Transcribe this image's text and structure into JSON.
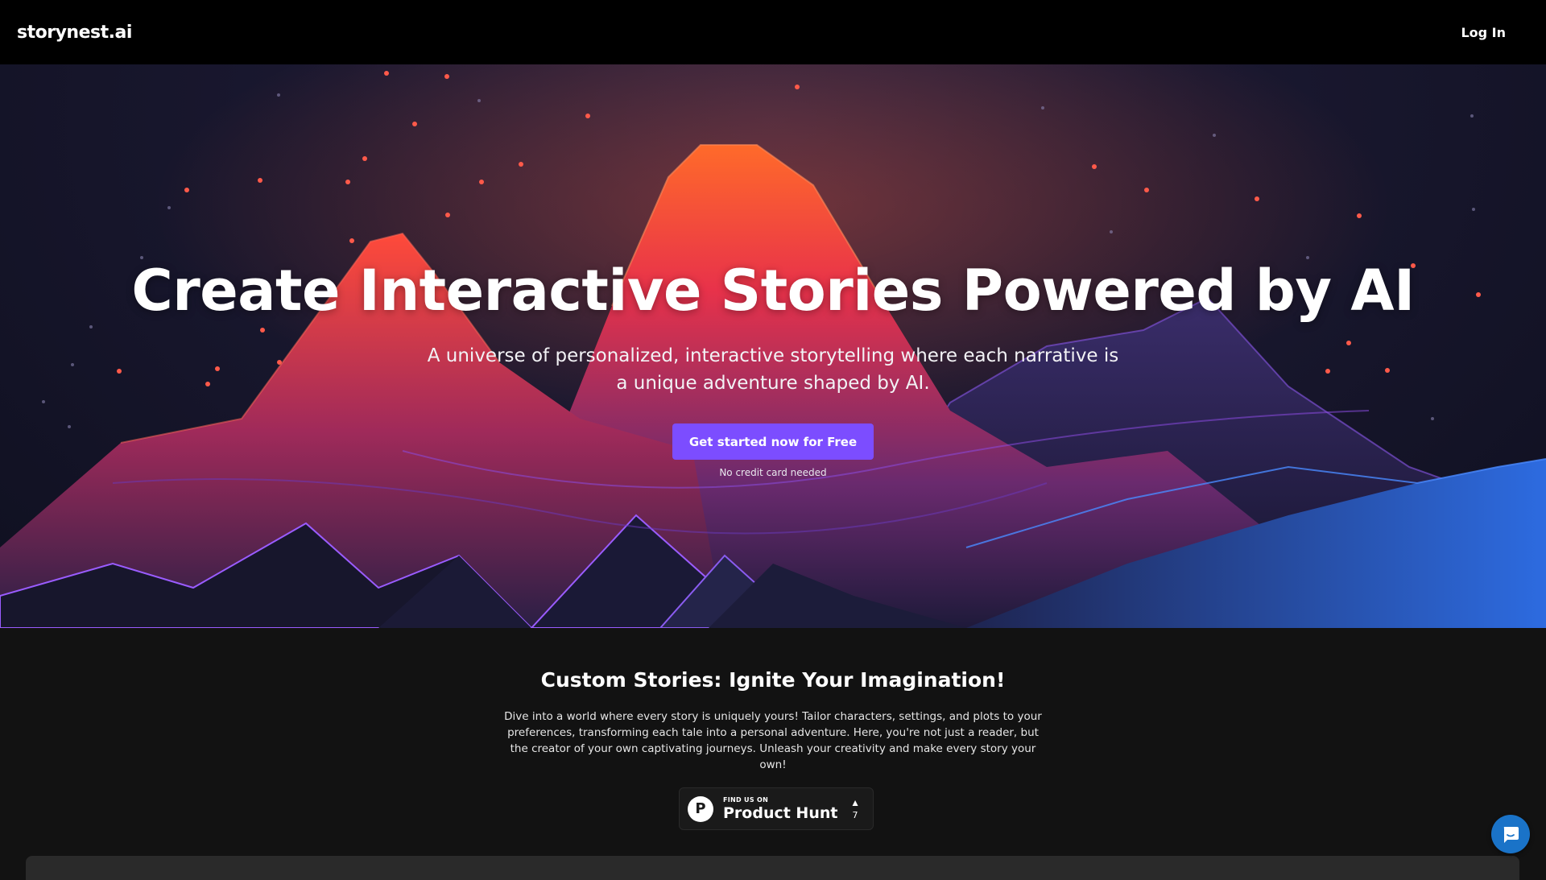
{
  "header": {
    "logo": "storynest.ai",
    "login_label": "Log In"
  },
  "hero": {
    "title": "Create Interactive Stories Powered by AI",
    "subtitle": "A universe of personalized, interactive storytelling where each narrative is a unique adventure shaped by AI.",
    "cta_label": "Get started now for Free",
    "note": "No credit card needed"
  },
  "section": {
    "title": "Custom Stories: Ignite Your Imagination!",
    "body": "Dive into a world where every story is uniquely yours! Tailor characters, settings, and plots to your preferences, transforming each tale into a personal adventure. Here, you're not just a reader, but the creator of your own captivating journeys. Unleash your creativity and make every story your own!"
  },
  "product_hunt": {
    "small": "FIND US ON",
    "big": "Product Hunt",
    "logo_letter": "P",
    "votes": "7",
    "arrow": "▲"
  },
  "colors": {
    "accent": "#7c4dff",
    "chat": "#1a73c8"
  }
}
